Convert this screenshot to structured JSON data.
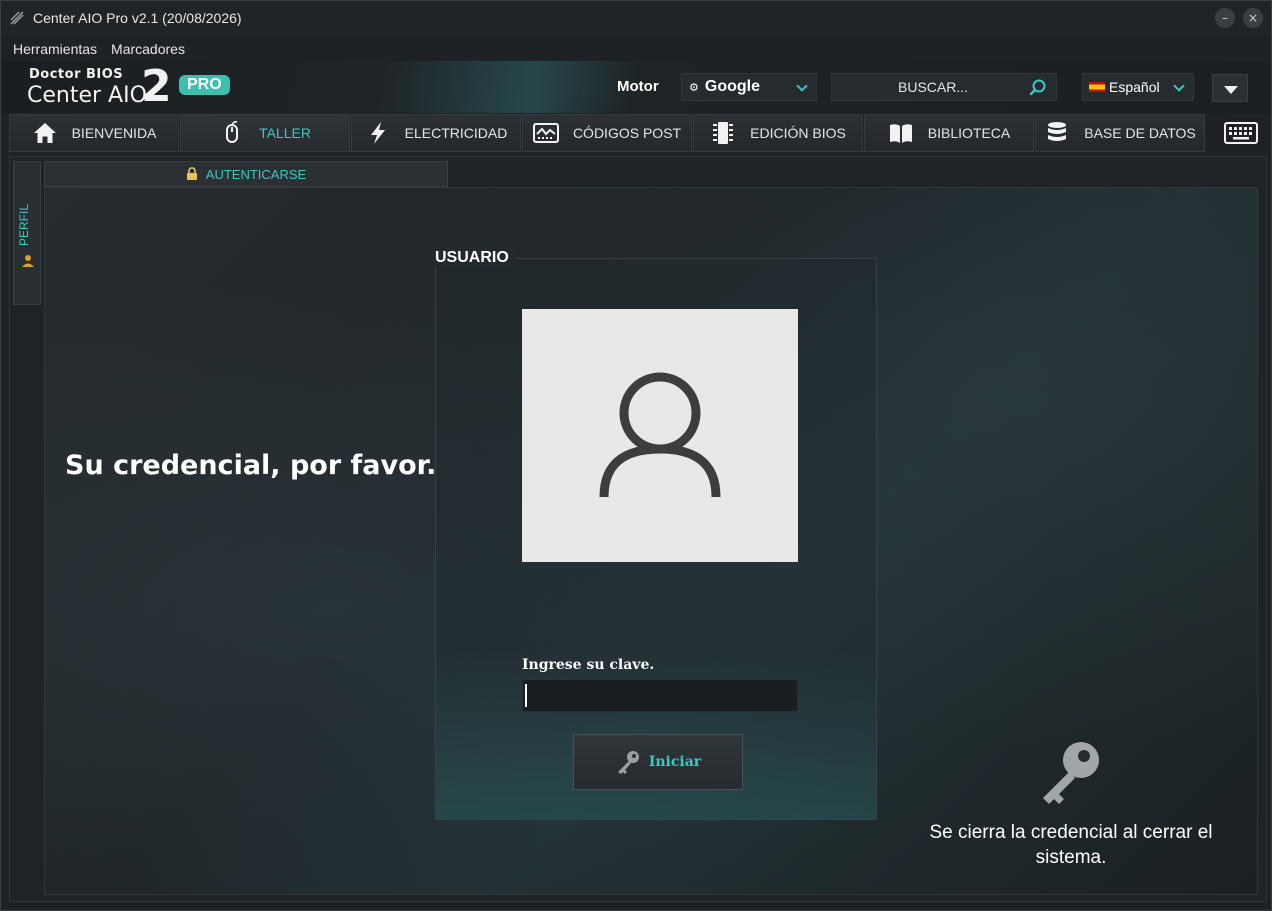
{
  "window": {
    "title": "Center AIO Pro v2.1 (20/08/2026)",
    "minimize_glyph": "–",
    "close_glyph": "×"
  },
  "menu": [
    "Herramientas",
    "Marcadores"
  ],
  "logo": {
    "line1": "Doctor BIOS",
    "line2": "Center AIO",
    "number": "2",
    "badge": "PRO"
  },
  "toolbar": {
    "motor_label": "Motor",
    "engine_value": "Google",
    "search_placeholder": "BUSCAR...",
    "language_value": "Español"
  },
  "tabs": [
    {
      "label": "BIENVENIDA",
      "icon": "home-icon",
      "active": false
    },
    {
      "label": "TALLER",
      "icon": "mouse-icon",
      "active": true
    },
    {
      "label": "ELECTRICIDAD",
      "icon": "lightning-icon",
      "active": false
    },
    {
      "label": "CÓDIGOS POST",
      "icon": "post-card-icon",
      "active": false
    },
    {
      "label": "EDICIÓN BIOS",
      "icon": "chip-icon",
      "active": false
    },
    {
      "label": "BIBLIOTECA",
      "icon": "book-icon",
      "active": false
    },
    {
      "label": "BASE DE DATOS",
      "icon": "database-icon",
      "active": false
    }
  ],
  "side_tab": {
    "label": "PERFIL",
    "icon": "user-icon"
  },
  "auth_tab": {
    "label": "AUTENTICARSE",
    "icon": "lock-icon"
  },
  "login": {
    "prompt": "Su credencial, por favor.",
    "group_title": "USUARIO",
    "password_label": "Ingrese su clave.",
    "password_value": "",
    "start_button": "Iniciar",
    "note": "Se cierra la credencial al cerrar el sistema."
  },
  "colors": {
    "accent": "#3cc9c0",
    "background": "#1e2226",
    "avatar_bg": "#e8e8e8"
  }
}
